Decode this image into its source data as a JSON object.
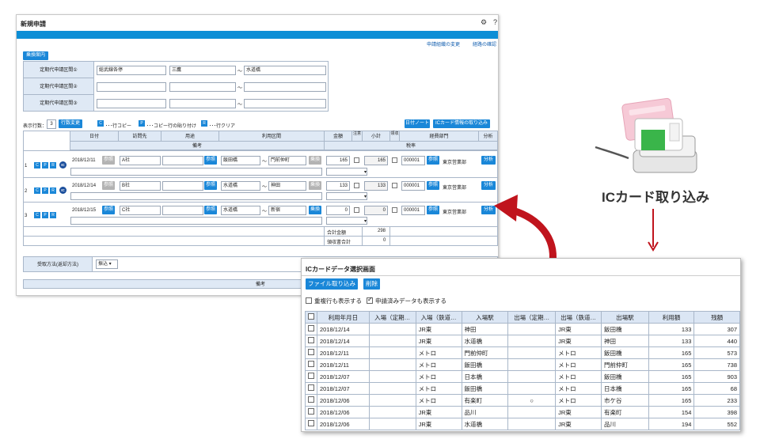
{
  "main": {
    "title": "新規申請",
    "header_links": [
      "申請組織の変更",
      "経路の確認"
    ],
    "transfer_button": "乗換案内",
    "commute": {
      "rows": [
        {
          "label": "定期代申請区間①",
          "route": "総武線各停",
          "from": "三鷹",
          "tilde": "～",
          "to": "水道橋"
        },
        {
          "label": "定期代申請区間②",
          "route": "",
          "from": "",
          "tilde": "～",
          "to": ""
        },
        {
          "label": "定期代申請区間③",
          "route": "",
          "from": "",
          "tilde": "～",
          "to": ""
        }
      ]
    },
    "toolbar": {
      "rows_label": "表示行数：",
      "rows_value": "3",
      "change_button": "行数変更",
      "c_key": "C",
      "c_text": "･･･行コピー",
      "p_key": "P",
      "p_text": "･･･コピー行の貼り付け",
      "r_key": "R",
      "r_text": "･･･行クリア",
      "date_note_button": "日付ノート",
      "ic_button": "ICカード情報の取り込み"
    },
    "grid": {
      "headers": {
        "date": "日付",
        "visit": "訪問先",
        "purpose": "用途",
        "section": "利用区間",
        "amount": "金額",
        "note": "注意",
        "subtotal": "小計",
        "receipt": "領収",
        "dept": "経費部門",
        "analysis": "分析",
        "remarks": "備考",
        "tax": "税率"
      },
      "ref_label": "参照",
      "swap_label": "乗換",
      "analysis_label": "分析",
      "row_buttons": [
        "C",
        "P",
        "R"
      ],
      "ic_badge": "IC",
      "rows": [
        {
          "no": "1",
          "date": "2018/12/11",
          "visit": "A社",
          "from": "飯田橋",
          "tilde": "～",
          "to": "門前仲町",
          "amount": "165",
          "subtotal": "165",
          "dept_code": "000001",
          "dept_name": "東京営業部"
        },
        {
          "no": "2",
          "date": "2018/12/14",
          "visit": "B社",
          "from": "水道橋",
          "tilde": "～",
          "to": "神田",
          "amount": "133",
          "subtotal": "133",
          "dept_code": "000001",
          "dept_name": "東京営業部"
        },
        {
          "no": "3",
          "date": "2018/12/15",
          "visit": "C社",
          "from": "水道橋",
          "tilde": "～",
          "to": "新宿",
          "amount": "0",
          "subtotal": "0",
          "dept_code": "000001",
          "dept_name": "東京営業部"
        }
      ],
      "total_label": "合計金額",
      "total_value": "298",
      "receipt_total_label": "領収書合計",
      "receipt_total_value": "0"
    },
    "receive": {
      "label": "受取方法(返却方法)",
      "value": "振込"
    },
    "footer_remarks": "備考"
  },
  "popup": {
    "title": "ICカードデータ選択画面",
    "file_button": "ファイル取り込み",
    "delete_button": "削除",
    "option1": "重複行も表示する",
    "option2": "申請済みデータも表示する",
    "columns": [
      "利用年月日",
      "入場（定期…",
      "入場（鉄道…",
      "入場駅",
      "出場（定期…",
      "出場（鉄道…",
      "出場駅",
      "利用額",
      "残額"
    ],
    "rows": [
      {
        "date": "2018/12/14",
        "in_pass": "",
        "in_rail": "JR東",
        "in_st": "神田",
        "out_pass": "",
        "out_rail": "JR東",
        "out_st": "飯田橋",
        "fare": "133",
        "balance": "307"
      },
      {
        "date": "2018/12/14",
        "in_pass": "",
        "in_rail": "JR東",
        "in_st": "水道橋",
        "out_pass": "",
        "out_rail": "JR東",
        "out_st": "神田",
        "fare": "133",
        "balance": "440"
      },
      {
        "date": "2018/12/11",
        "in_pass": "",
        "in_rail": "メトロ",
        "in_st": "門前仲町",
        "out_pass": "",
        "out_rail": "メトロ",
        "out_st": "飯田橋",
        "fare": "165",
        "balance": "573"
      },
      {
        "date": "2018/12/11",
        "in_pass": "",
        "in_rail": "メトロ",
        "in_st": "飯田橋",
        "out_pass": "",
        "out_rail": "メトロ",
        "out_st": "門前仲町",
        "fare": "165",
        "balance": "738"
      },
      {
        "date": "2018/12/07",
        "in_pass": "",
        "in_rail": "メトロ",
        "in_st": "日本橋",
        "out_pass": "",
        "out_rail": "メトロ",
        "out_st": "飯田橋",
        "fare": "165",
        "balance": "903"
      },
      {
        "date": "2018/12/07",
        "in_pass": "",
        "in_rail": "メトロ",
        "in_st": "飯田橋",
        "out_pass": "",
        "out_rail": "メトロ",
        "out_st": "日本橋",
        "fare": "165",
        "balance": "68"
      },
      {
        "date": "2018/12/06",
        "in_pass": "",
        "in_rail": "メトロ",
        "in_st": "有楽町",
        "out_pass": "○",
        "out_rail": "メトロ",
        "out_st": "市ケ谷",
        "fare": "165",
        "balance": "233"
      },
      {
        "date": "2018/12/06",
        "in_pass": "",
        "in_rail": "JR東",
        "in_st": "品川",
        "out_pass": "",
        "out_rail": "JR東",
        "out_st": "有楽町",
        "fare": "154",
        "balance": "398"
      },
      {
        "date": "2018/12/06",
        "in_pass": "",
        "in_rail": "JR東",
        "in_st": "水道橋",
        "out_pass": "",
        "out_rail": "JR東",
        "out_st": "品川",
        "fare": "194",
        "balance": "552"
      }
    ]
  },
  "illustration": {
    "caption": "ICカード取り込み",
    "card_colors": {
      "pink": "#f5c6d4",
      "green": "#3ab54a",
      "arrow_red": "#c0141d",
      "reader": "#e8e8e8"
    }
  }
}
